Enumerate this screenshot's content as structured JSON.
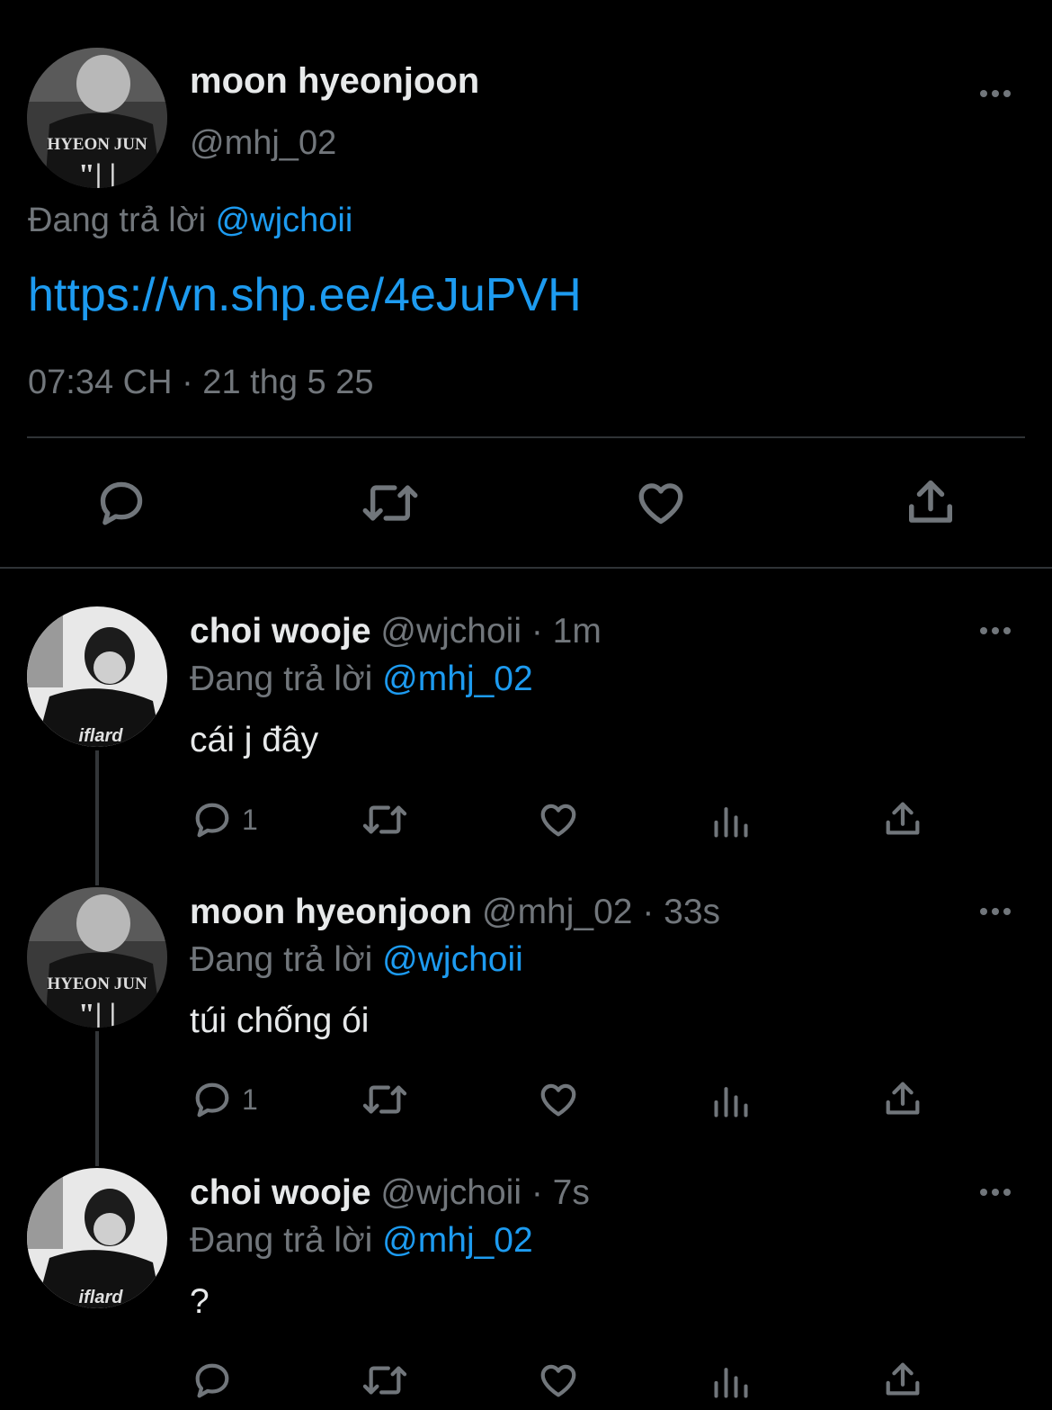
{
  "main_tweet": {
    "name": "moon hyeonjoon",
    "handle": "@mhj_02",
    "replying_label": "Đang trả lời",
    "replying_to": "@wjchoii",
    "link": "https://vn.shp.ee/4eJuPVH",
    "timestamp": "07:34 CH · 21 thg 5 25",
    "avatar_jersey_text": "HYEON JUN"
  },
  "replies": [
    {
      "name": "choi wooje",
      "handle": "@wjchoii",
      "time": "· 1m",
      "replying_label": "Đang trả lời",
      "replying_to": "@mhj_02",
      "text": "cái j đây",
      "reply_count": "1",
      "avatar_jersey_text": "iflard"
    },
    {
      "name": "moon hyeonjoon",
      "handle": "@mhj_02",
      "time": "· 33s",
      "replying_label": "Đang trả lời",
      "replying_to": "@wjchoii",
      "text": "túi chống ói",
      "reply_count": "1",
      "avatar_jersey_text": "HYEON JUN"
    },
    {
      "name": "choi wooje",
      "handle": "@wjchoii",
      "time": "· 7s",
      "replying_label": "Đang trả lời",
      "replying_to": "@mhj_02",
      "text": "?",
      "reply_count": "",
      "avatar_jersey_text": "iflard"
    }
  ],
  "icons": {
    "reply": "reply-icon",
    "retweet": "retweet-icon",
    "like": "heart-icon",
    "views": "views-icon",
    "share": "share-icon",
    "more": "more-icon"
  },
  "colors": {
    "background": "#000000",
    "text": "#e7e9ea",
    "muted": "#71767b",
    "accent": "#1d9bf0",
    "divider": "#2f3336"
  }
}
